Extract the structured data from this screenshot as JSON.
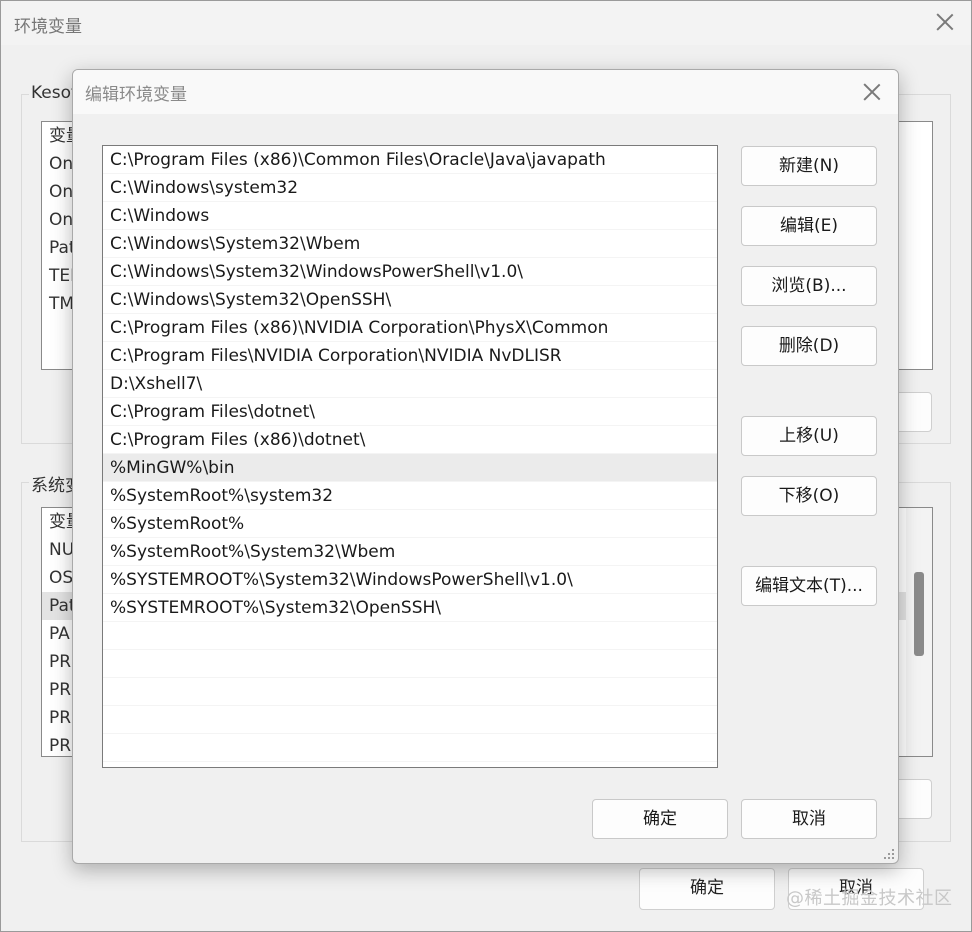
{
  "background_window": {
    "title": "环境变量",
    "user_group_label": "Kesof",
    "user_list": {
      "header": "变量",
      "rows": [
        "On",
        "On",
        "On",
        "Pat",
        "TEI",
        "TM"
      ]
    },
    "system_group_label": "系统变",
    "system_list": {
      "header": "变量",
      "rows": [
        "NU",
        "OS",
        "Pat",
        "PA",
        "PR",
        "PR",
        "PR",
        "PR"
      ]
    },
    "ok_label": "确定",
    "cancel_label": "取消"
  },
  "dialog": {
    "title": "编辑环境变量",
    "paths": [
      "C:\\Program Files (x86)\\Common Files\\Oracle\\Java\\javapath",
      "C:\\Windows\\system32",
      "C:\\Windows",
      "C:\\Windows\\System32\\Wbem",
      "C:\\Windows\\System32\\WindowsPowerShell\\v1.0\\",
      "C:\\Windows\\System32\\OpenSSH\\",
      "C:\\Program Files (x86)\\NVIDIA Corporation\\PhysX\\Common",
      "C:\\Program Files\\NVIDIA Corporation\\NVIDIA NvDLISR",
      "D:\\Xshell7\\",
      "C:\\Program Files\\dotnet\\",
      "C:\\Program Files (x86)\\dotnet\\",
      "%MinGW%\\bin",
      "%SystemRoot%\\system32",
      "%SystemRoot%",
      "%SystemRoot%\\System32\\Wbem",
      "%SYSTEMROOT%\\System32\\WindowsPowerShell\\v1.0\\",
      "%SYSTEMROOT%\\System32\\OpenSSH\\"
    ],
    "selected_path": "%MinGW%\\bin",
    "buttons": {
      "new": "新建(N)",
      "edit": "编辑(E)",
      "browse": "浏览(B)...",
      "delete": "删除(D)",
      "move_up": "上移(U)",
      "move_down": "下移(O)",
      "edit_text": "编辑文本(T)..."
    },
    "ok_label": "确定",
    "cancel_label": "取消"
  },
  "watermark": "@稀土掘金技术社区"
}
